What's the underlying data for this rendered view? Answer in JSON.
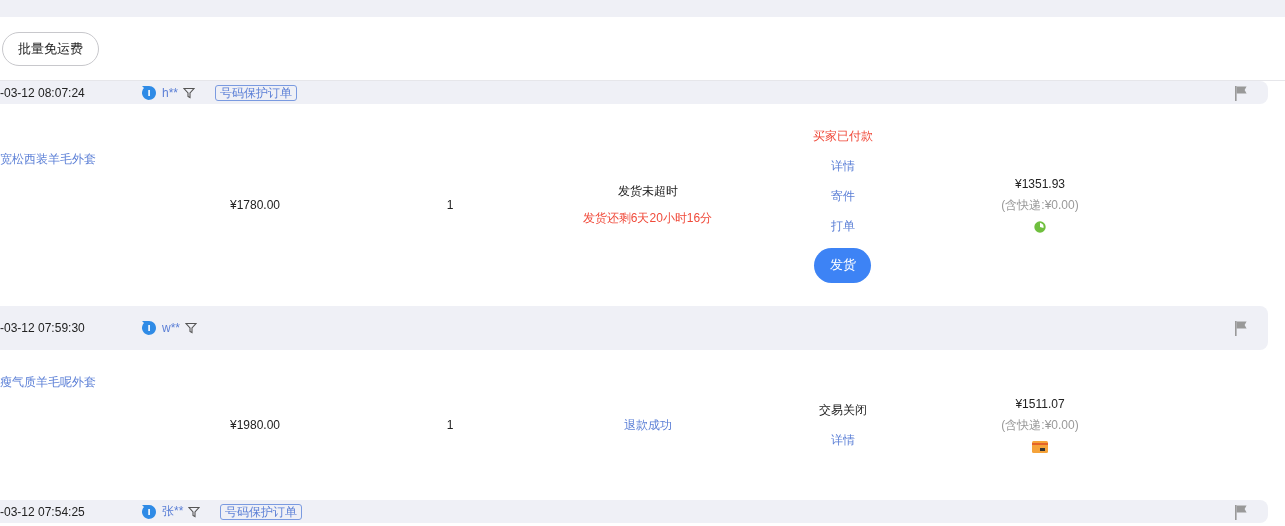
{
  "toolbar": {
    "button": "批量免运费"
  },
  "orders": [
    {
      "time": "-03-12 08:07:24",
      "buyer": "h**",
      "tag": "号码保护订单",
      "title": "宽松西装羊毛外套",
      "price": "¥1780.00",
      "quantity": "1",
      "status": [
        {
          "kind": "plain",
          "text": "发货未超时"
        },
        {
          "kind": "alert",
          "text": "发货还剩6天20小时16分"
        }
      ],
      "actions": [
        {
          "kind": "alert",
          "text": "买家已付款"
        },
        {
          "kind": "link",
          "text": "详情"
        },
        {
          "kind": "link",
          "text": "寄件"
        },
        {
          "kind": "link",
          "text": "打单"
        },
        {
          "kind": "button",
          "text": "发货"
        }
      ],
      "total": "¥1351.93",
      "shipping": "(含快递:¥0.00)",
      "payment_icon": {
        "kind": "wallet"
      }
    },
    {
      "time": "-03-12 07:59:30",
      "buyer": "w**",
      "title": "瘦气质羊毛呢外套",
      "price": "¥1980.00",
      "quantity": "1",
      "status": [
        {
          "kind": "link",
          "text": "退款成功"
        }
      ],
      "actions": [
        {
          "kind": "plain",
          "text": "交易关闭"
        },
        {
          "kind": "link",
          "text": "详情"
        }
      ],
      "total": "¥1511.07",
      "shipping": "(含快递:¥0.00)",
      "payment_icon": {
        "kind": "card"
      }
    },
    {
      "time": "-03-12 07:54:25",
      "buyer": "张**",
      "tag": "号码保护订单"
    }
  ]
}
